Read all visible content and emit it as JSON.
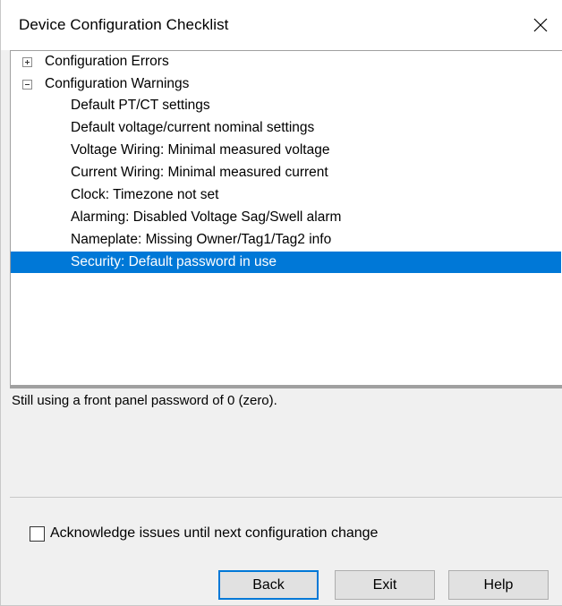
{
  "window": {
    "title": "Device Configuration Checklist"
  },
  "tree": {
    "groups": [
      {
        "label": "Configuration Errors",
        "expanded": false,
        "icon": "plus-icon"
      },
      {
        "label": "Configuration Warnings",
        "expanded": true,
        "icon": "minus-icon"
      }
    ],
    "warnings": [
      "Default PT/CT settings",
      "Default voltage/current nominal settings",
      "Voltage Wiring: Minimal measured voltage",
      "Current Wiring: Minimal measured current",
      "Clock: Timezone not set",
      "Alarming: Disabled Voltage Sag/Swell alarm",
      "Nameplate: Missing Owner/Tag1/Tag2 info",
      "Security: Default password in use"
    ],
    "selected_index": 7
  },
  "description": {
    "text": "Still using a front panel password of 0 (zero)."
  },
  "acknowledge": {
    "label": "Acknowledge issues until next configuration change",
    "checked": false
  },
  "buttons": {
    "back": "Back",
    "exit": "Exit",
    "help": "Help"
  },
  "colors": {
    "selection": "#0078d7",
    "background": "#f0f0f0"
  }
}
